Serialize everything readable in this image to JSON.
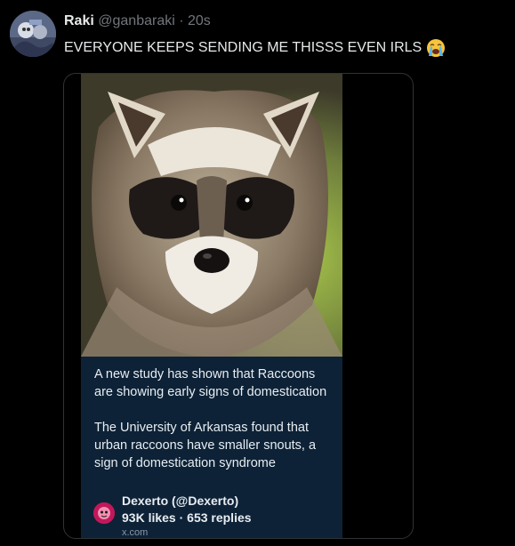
{
  "tweet": {
    "display_name": "Raki",
    "handle": "@ganbaraki",
    "separator": "·",
    "time": "20s",
    "text": "EVERYONE KEEPS SENDING ME THISSS EVEN IRLS",
    "emoji": "loudly-crying-face-icon"
  },
  "embedded": {
    "caption_p1": "A new study has shown that Raccoons are showing early signs of domestication",
    "caption_p2": "The University of Arkansas found that urban raccoons have smaller snouts, a sign of domestication syndrome",
    "source_name": "Dexerto (@Dexerto)",
    "source_stats": "93K likes · 653 replies",
    "source_domain": "x.com"
  },
  "colors": {
    "background": "#000000",
    "text": "#e7e9ea",
    "muted": "#71767b",
    "card_background": "#0d2236"
  }
}
